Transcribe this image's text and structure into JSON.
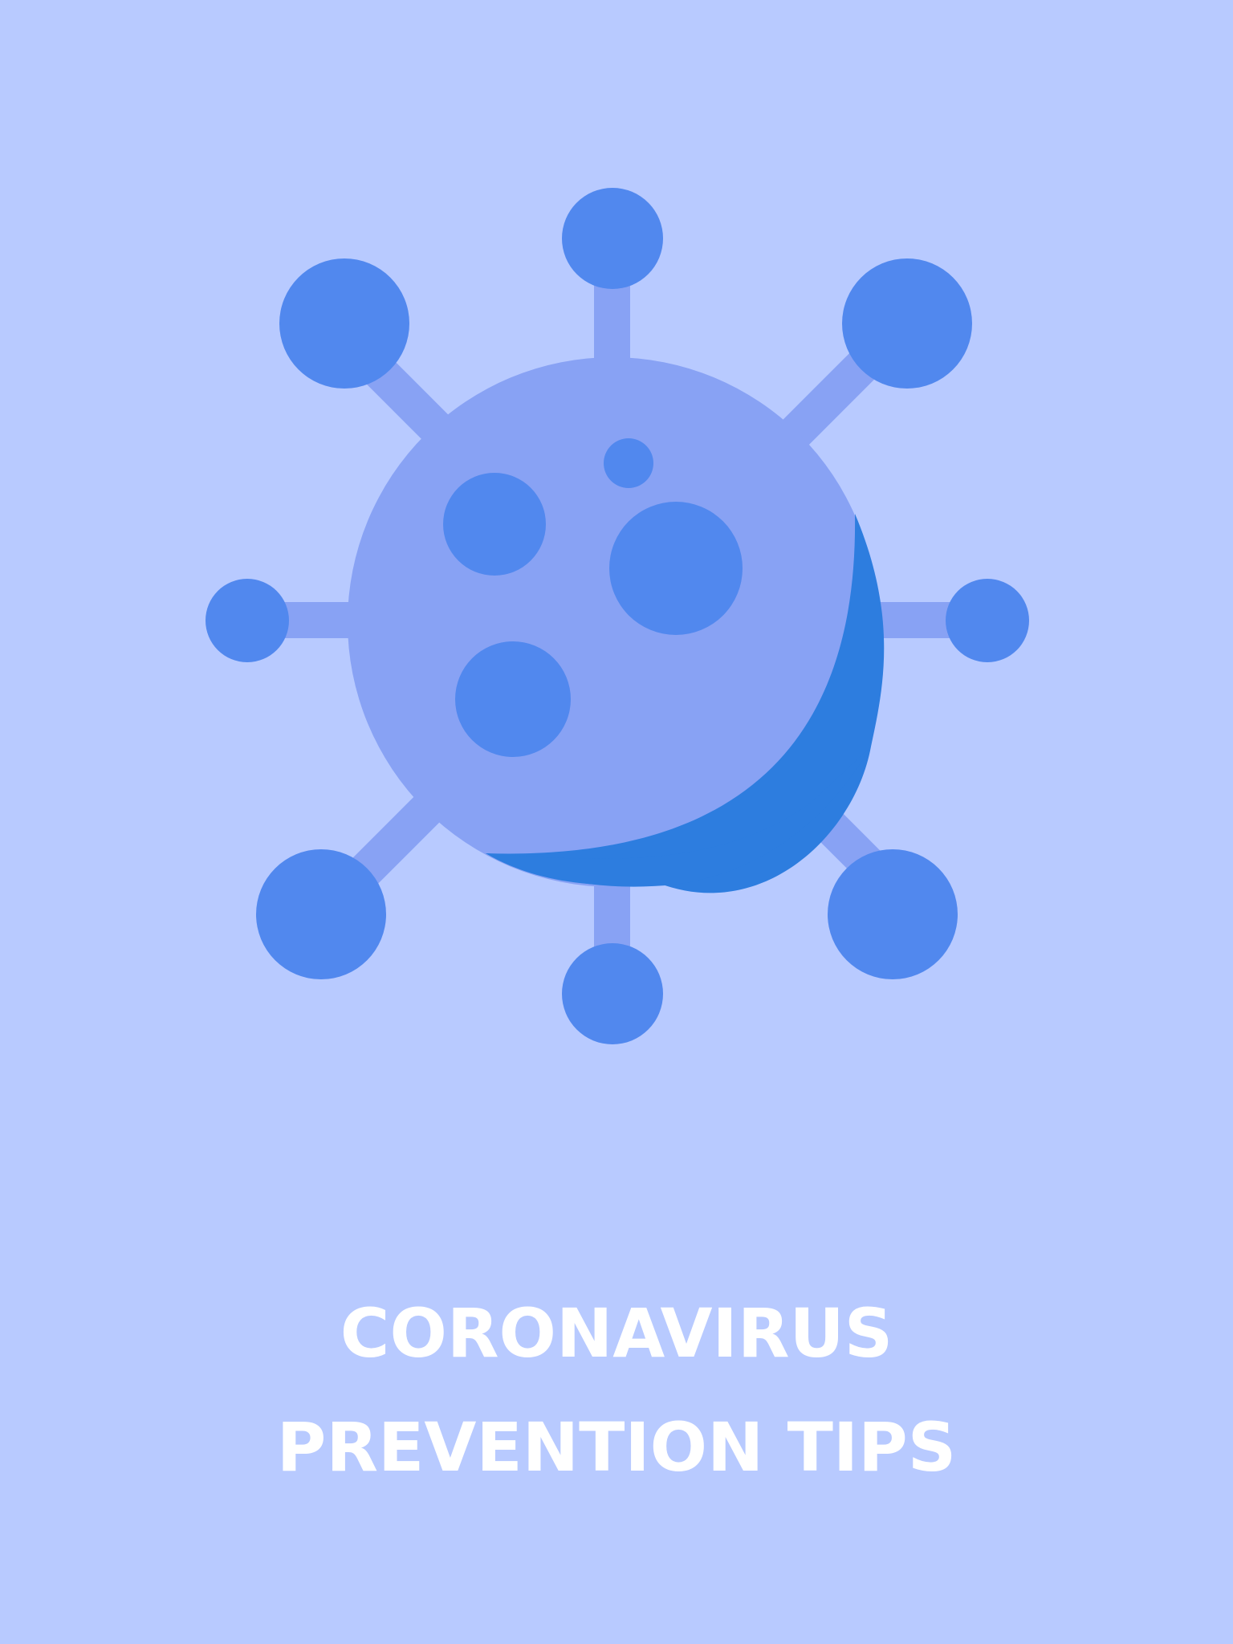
{
  "illustration": {
    "icon": "coronavirus-icon",
    "colors": {
      "background": "#b8caff",
      "body": "#88a2f4",
      "spike_stem": "#88a2f4",
      "spike_ball": "#5188ee",
      "spot": "#5188ee",
      "shadow": "#2d7ddf"
    }
  },
  "title": {
    "line1": "CORONAVIRUS",
    "line2": "PREVENTION TIPS",
    "color": "#ffffff"
  }
}
